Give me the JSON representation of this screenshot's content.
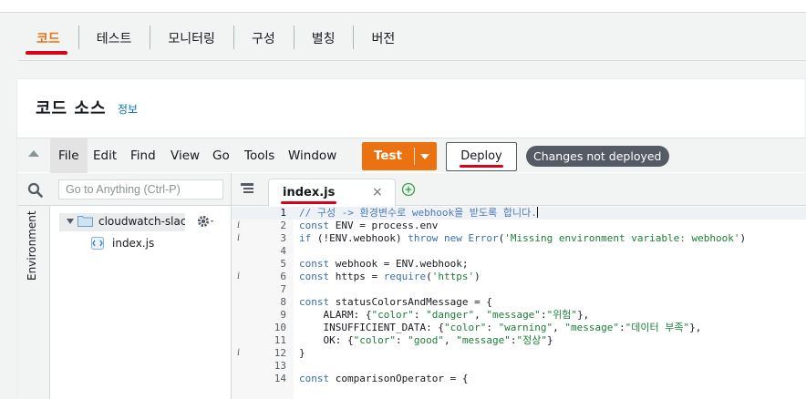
{
  "tabs": [
    {
      "label": "코드",
      "active": true
    },
    {
      "label": "테스트",
      "active": false
    },
    {
      "label": "모니터링",
      "active": false
    },
    {
      "label": "구성",
      "active": false
    },
    {
      "label": "별칭",
      "active": false
    },
    {
      "label": "버전",
      "active": false
    }
  ],
  "card": {
    "title": "코드 소스",
    "info_link": "정보"
  },
  "menubar": {
    "items": [
      "File",
      "Edit",
      "Find",
      "View",
      "Go",
      "Tools",
      "Window"
    ],
    "active": "File",
    "test_label": "Test",
    "deploy_label": "Deploy",
    "status_badge": "Changes not deployed"
  },
  "sidebar": {
    "search_placeholder": "Go to Anything (Ctrl-P)",
    "environment_label": "Environment",
    "folder_name": "cloudwatch-slack-al",
    "file_name": "index.js"
  },
  "editor": {
    "tab_name": "index.js",
    "close_glyph": "×",
    "lines": [
      {
        "num": "1",
        "mark": "",
        "text": "// 구성 -> 환경변수로 webhook을 받도록 합니다."
      },
      {
        "num": "2",
        "mark": "i",
        "text": "const ENV = process.env"
      },
      {
        "num": "3",
        "mark": "i",
        "text": "if (!ENV.webhook) throw new Error('Missing environment variable: webhook')"
      },
      {
        "num": "4",
        "mark": "",
        "text": ""
      },
      {
        "num": "5",
        "mark": "",
        "text": "const webhook = ENV.webhook;"
      },
      {
        "num": "6",
        "mark": "i",
        "text": "const https = require('https')"
      },
      {
        "num": "7",
        "mark": "",
        "text": ""
      },
      {
        "num": "8",
        "mark": "",
        "text": "const statusColorsAndMessage = {"
      },
      {
        "num": "9",
        "mark": "",
        "text": "    ALARM: {\"color\": \"danger\", \"message\":\"위험\"},"
      },
      {
        "num": "10",
        "mark": "",
        "text": "    INSUFFICIENT_DATA: {\"color\": \"warning\", \"message\":\"데이터 부족\"},"
      },
      {
        "num": "11",
        "mark": "",
        "text": "    OK: {\"color\": \"good\", \"message\":\"정상\"}"
      },
      {
        "num": "12",
        "mark": "i",
        "text": "}"
      },
      {
        "num": "13",
        "mark": "",
        "text": ""
      },
      {
        "num": "14",
        "mark": "",
        "text": "const comparisonOperator = {"
      }
    ]
  },
  "colors": {
    "accent_orange": "#ec7211",
    "active_tab_text": "#ec7211",
    "annotation_red": "#d9001b",
    "link_blue": "#0073bb",
    "badge_gray": "#545b64"
  },
  "icons": {
    "collapse": "caret-up-icon",
    "search": "search-icon",
    "folder": "folder-icon",
    "file": "js-file-icon",
    "gear": "gear-icon",
    "tabs_list": "tabs-list-icon",
    "add_tab": "plus-circle-icon"
  }
}
